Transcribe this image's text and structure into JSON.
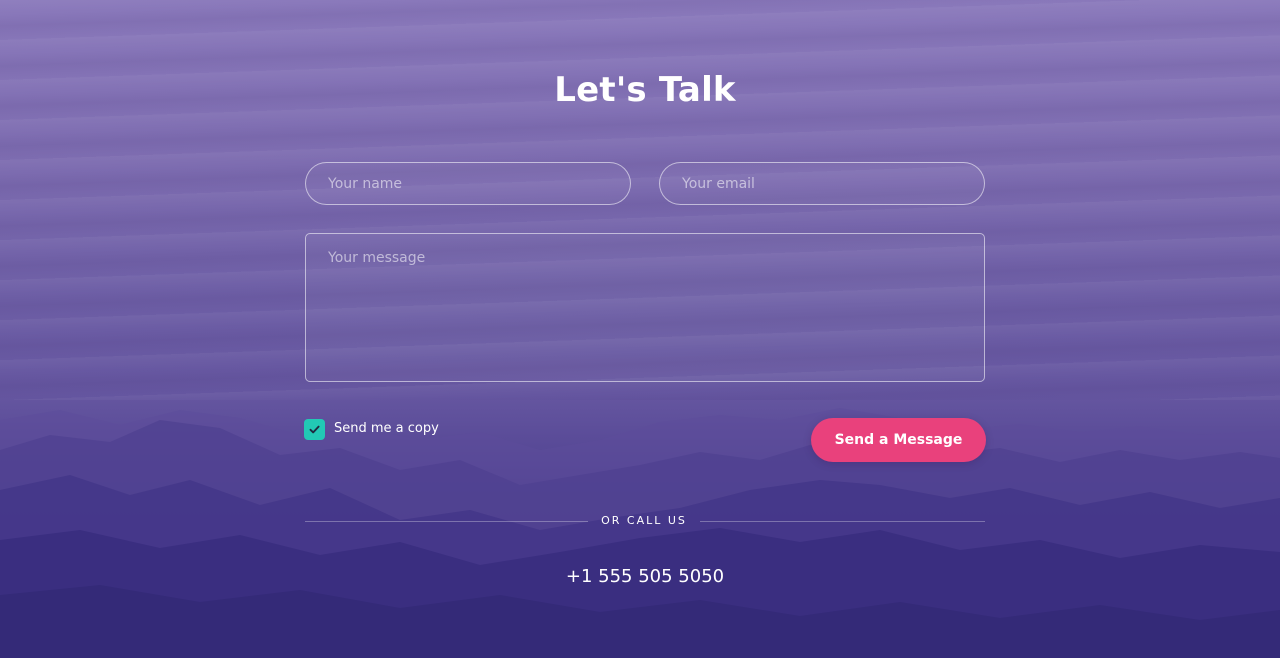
{
  "title": "Let's Talk",
  "form": {
    "name_placeholder": "Your name",
    "email_placeholder": "Your email",
    "message_placeholder": "Your message",
    "copy_label": "Send me a copy",
    "copy_checked": true,
    "submit_label": "Send a Message"
  },
  "call": {
    "divider_label": "OR CALL US",
    "phone": "+1 555 505 5050"
  },
  "colors": {
    "accent": "#e9417c",
    "checkbox": "#22c9b5",
    "background": "#6e5fa6"
  }
}
